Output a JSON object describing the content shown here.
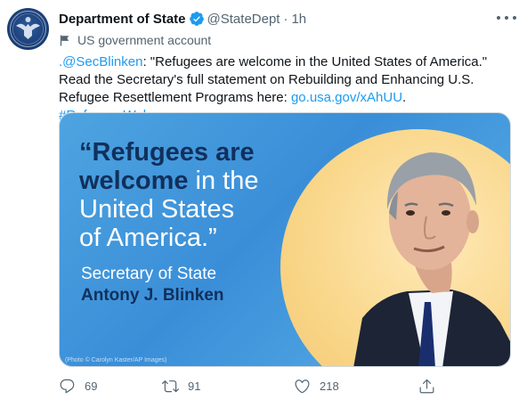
{
  "tweet": {
    "author_name": "Department of State",
    "handle": "@StateDept",
    "separator": "·",
    "time": "1h",
    "account_label": "US government account",
    "text": {
      "mention": ".@SecBlinken",
      "body": ": \"Refugees are welcome in the United States of America.\" Read the Secretary's full statement on Rebuilding and Enhancing U.S. Refugee Resettlement Programs here: ",
      "link": "go.usa.gov/xAhUU",
      "space": ". ",
      "hashtag": "#RefugeesWelcome"
    }
  },
  "media": {
    "quote_line1": "“Refugees are",
    "quote_line2_bold": "welcome",
    "quote_line2_lite": " in the",
    "quote_line3": "United States",
    "quote_line4": "of America.”",
    "role": "Secretary of State",
    "person": "Antony J. Blinken",
    "credit": "(Photo © Carolyn Kaster/AP Images)"
  },
  "actions": {
    "replies": "69",
    "retweets": "91",
    "likes": "218"
  },
  "colors": {
    "accent": "#1d9bf0",
    "text": "#0f1419",
    "muted": "#536471",
    "quote_navy": "#11305c"
  },
  "icons": [
    "verified-badge-icon",
    "flag-icon",
    "more-icon",
    "reply-icon",
    "retweet-icon",
    "like-icon",
    "share-icon"
  ]
}
